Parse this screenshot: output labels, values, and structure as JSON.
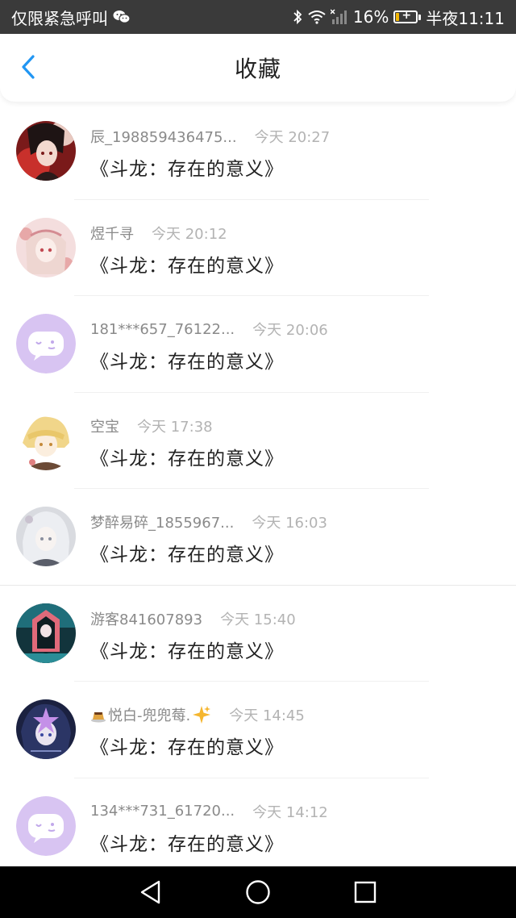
{
  "status_bar": {
    "carrier": "仅限紧急呼叫",
    "battery_percent": "16%",
    "time": "半夜11:11",
    "icons": [
      "wechat-icon",
      "bluetooth-icon",
      "wifi-icon",
      "signal-icon",
      "battery-icon"
    ],
    "battery_level": 0.16
  },
  "header": {
    "title": "收藏",
    "back_icon": "chevron-left-icon",
    "accent": "#2196f3"
  },
  "favorites": [
    {
      "user": "辰_198859436475...",
      "time": "今天 20:27",
      "title": "《斗龙：存在的意义》",
      "avatar": "anime-portrait-red"
    },
    {
      "user": "煜千寻",
      "time": "今天 20:12",
      "title": "《斗龙：存在的意义》",
      "avatar": "anime-portrait-pink"
    },
    {
      "user": "181***657_76122...",
      "time": "今天 20:06",
      "title": "《斗龙：存在的意义》",
      "avatar": "default-chat-avatar"
    },
    {
      "user": "空宝",
      "time": "今天 17:38",
      "title": "《斗龙：存在的意义》",
      "avatar": "anime-portrait-blonde"
    },
    {
      "user": "梦醉易碎_1855967...",
      "time": "今天 16:03",
      "title": "《斗龙：存在的意义》",
      "avatar": "anime-portrait-grey"
    },
    {
      "user": "游客841607893",
      "time": "今天 15:40",
      "title": "《斗龙：存在的意义》",
      "avatar": "anime-portrait-teal"
    },
    {
      "user": "悦白-兜兜莓.",
      "time": "今天 14:45",
      "title": "《斗龙：存在的意义》",
      "avatar": "anime-portrait-dark",
      "user_prefix_icon": "pudding-icon",
      "user_suffix_icon": "sparkle-icon"
    },
    {
      "user": "134***731_61720...",
      "time": "今天 14:12",
      "title": "《斗龙：存在的意义》",
      "avatar": "default-chat-avatar"
    }
  ],
  "nav_bar": {
    "back": "triangle-back-icon",
    "home": "circle-home-icon",
    "recent": "square-recent-icon"
  }
}
